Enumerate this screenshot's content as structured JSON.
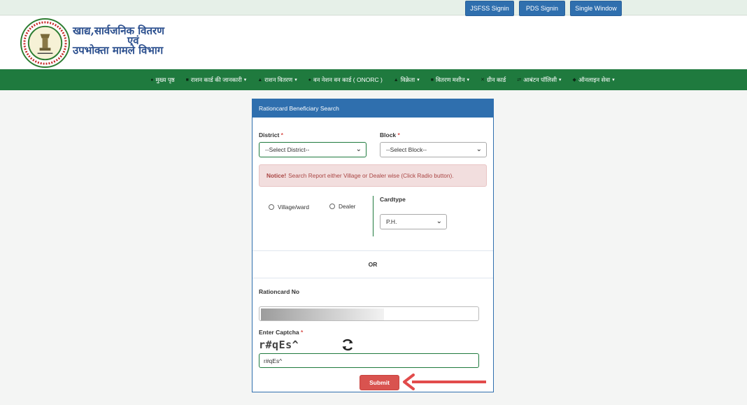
{
  "topbar": {
    "buttons": [
      "JSFSS Signin",
      "PDS Signin",
      "Single Window"
    ]
  },
  "header": {
    "title_line1": "खाद्य,सार्वजनिक वितरण",
    "title_line2": "एवं",
    "title_line3": "उपभोक्ता मामले विभाग"
  },
  "nav": [
    {
      "icon": "home-icon",
      "label": "मुख्य पृष्ठ",
      "caret": ""
    },
    {
      "icon": "card-icon",
      "label": "राशन कार्ड की जानकारी",
      "caret": "▾"
    },
    {
      "icon": "user-icon",
      "label": "राशन वितरण",
      "caret": "▾"
    },
    {
      "icon": "globe-icon",
      "label": "वन नेशन वन कार्ड ( ONORC )",
      "caret": ""
    },
    {
      "icon": "user-icon",
      "label": "विक्रेता",
      "caret": "▾"
    },
    {
      "icon": "machine-icon",
      "label": "वितरण मशीन",
      "caret": "▾"
    },
    {
      "icon": "wand-icon",
      "label": "ग्रीन कार्ड",
      "caret": ""
    },
    {
      "icon": "shuffle-icon",
      "label": "आबंटन पॉलिसी",
      "caret": "▾"
    },
    {
      "icon": "shield-icon",
      "label": "ऑनलाइन सेवा",
      "caret": "▾"
    }
  ],
  "form": {
    "header": "Rationcard Beneficiary Search",
    "district_label": "District",
    "district_value": "--Select District--",
    "block_label": "Block",
    "block_value": "--Select Block--",
    "required_mark": "*",
    "notice_bold": "Notice!",
    "notice_text": "Search Report either Village or Dealer wise (Click Radio button).",
    "radio_village": "Village/ward",
    "radio_dealer": "Dealer",
    "cardtype_label": "Cardtype",
    "cardtype_value": "P.H.",
    "or_text": "OR",
    "rationcard_label": "Rationcard No",
    "captcha_label": "Enter Captcha",
    "captcha_image_text": "r#qEs^",
    "captcha_input_value": "r#qEs^",
    "submit_label": "Submit"
  },
  "colors": {
    "nav_green": "#1f7a3e",
    "primary_blue": "#2f6fae",
    "danger_red": "#d9534f"
  }
}
